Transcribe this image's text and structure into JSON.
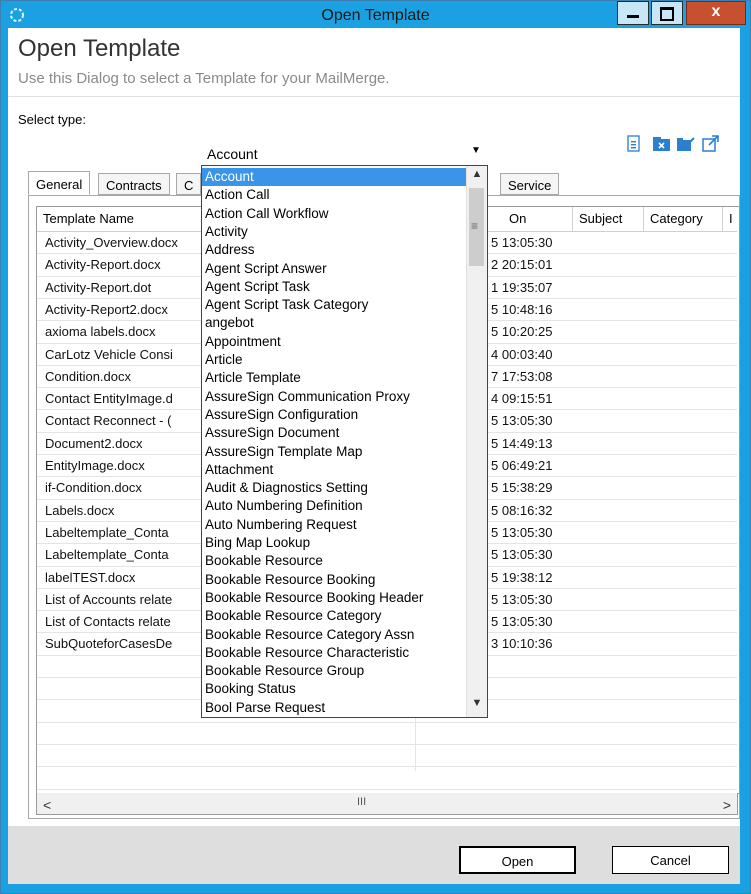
{
  "window": {
    "title": "Open Template",
    "close_glyph": "x"
  },
  "header": {
    "title": "Open Template",
    "description": "Use this Dialog to select a Template for your MailMerge."
  },
  "select_type": {
    "label": "Select type:",
    "value": "Account"
  },
  "toolbar": {
    "icons": [
      "document-icon",
      "delete-icon",
      "edit-icon",
      "external-link-icon"
    ],
    "accent": "#2a7fcf"
  },
  "tabs": [
    {
      "label": "General",
      "active": true
    },
    {
      "label": "Contracts",
      "active": false
    },
    {
      "label": "C",
      "active": false
    },
    {
      "label": "Service",
      "active": false
    }
  ],
  "grid": {
    "columns": [
      "Template Name",
      "Modified On",
      "Subject",
      "Category",
      "I"
    ],
    "header_visible": [
      "Template Name",
      "On",
      "Subject",
      "Category",
      "I"
    ],
    "rows": [
      {
        "name": "Activity_Overview.docx",
        "modified": "5 13:05:30"
      },
      {
        "name": "Activity-Report.docx",
        "modified": "2 20:15:01"
      },
      {
        "name": "Activity-Report.dot",
        "modified": "1 19:35:07"
      },
      {
        "name": "Activity-Report2.docx",
        "modified": "5 10:48:16"
      },
      {
        "name": "axioma labels.docx",
        "modified": "5 10:20:25"
      },
      {
        "name": "CarLotz Vehicle Consi",
        "modified": "4 00:03:40"
      },
      {
        "name": "Condition.docx",
        "modified": "7 17:53:08"
      },
      {
        "name": "Contact EntityImage.d",
        "modified": "4 09:15:51"
      },
      {
        "name": "Contact Reconnect - (",
        "modified": "5 13:05:30"
      },
      {
        "name": "Document2.docx",
        "modified": "5 14:49:13"
      },
      {
        "name": "EntityImage.docx",
        "modified": "5 06:49:21"
      },
      {
        "name": "if-Condition.docx",
        "modified": "5 15:38:29"
      },
      {
        "name": "Labels.docx",
        "modified": "5 08:16:32"
      },
      {
        "name": "Labeltemplate_Conta",
        "modified": "5 13:05:30"
      },
      {
        "name": "Labeltemplate_Conta",
        "modified": "5 13:05:30"
      },
      {
        "name": "labelTEST.docx",
        "modified": "5 19:38:12"
      },
      {
        "name": "List of Accounts relate",
        "modified": "5 13:05:30"
      },
      {
        "name": "List of Contacts relate",
        "modified": "5 13:05:30"
      },
      {
        "name": "SubQuoteforCasesDe",
        "modified": "3 10:10:36"
      }
    ]
  },
  "dropdown": {
    "selected": "Account",
    "items": [
      "Account",
      "Action Call",
      "Action Call Workflow",
      "Activity",
      "Address",
      "Agent Script Answer",
      "Agent Script Task",
      "Agent Script Task Category",
      "angebot",
      "Appointment",
      "Article",
      "Article Template",
      "AssureSign Communication Proxy",
      "AssureSign Configuration",
      "AssureSign Document",
      "AssureSign Template Map",
      "Attachment",
      "Audit & Diagnostics Setting",
      "Auto Numbering Definition",
      "Auto Numbering Request",
      "Bing Map Lookup",
      "Bookable Resource",
      "Bookable Resource Booking",
      "Bookable Resource Booking Header",
      "Bookable Resource Category",
      "Bookable Resource Category Assn",
      "Bookable Resource Characteristic",
      "Bookable Resource Group",
      "Booking Status",
      "Bool Parse Request"
    ]
  },
  "buttons": {
    "open": "Open",
    "cancel": "Cancel"
  },
  "scrollbar": {
    "left": "<",
    "right": ">",
    "thumb": "III"
  }
}
